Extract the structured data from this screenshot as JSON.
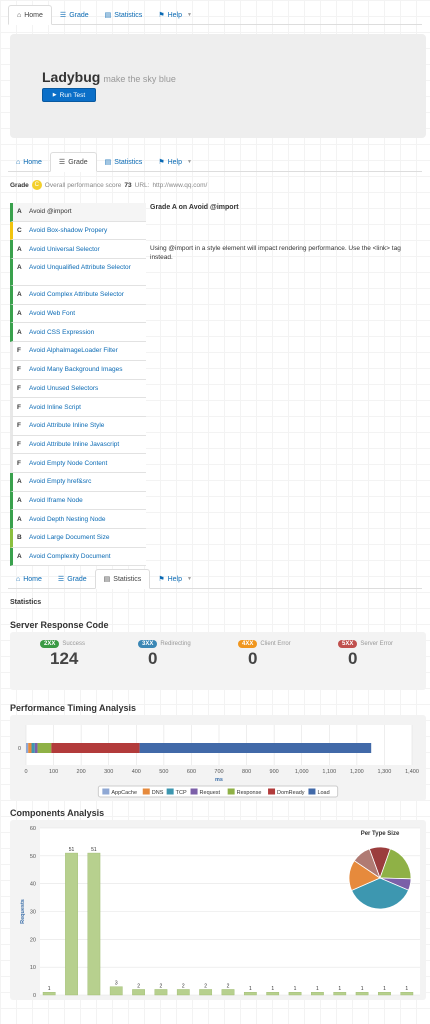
{
  "nav": {
    "tabs": [
      {
        "label": "Home"
      },
      {
        "label": "Grade"
      },
      {
        "label": "Statistics"
      },
      {
        "label": "Help"
      }
    ]
  },
  "hero": {
    "title": "Ladybug",
    "tagline": "make the sky blue",
    "button": "Run Test"
  },
  "grade": {
    "label": "Grade",
    "letter": "C",
    "score_label": "Overall performance score",
    "score": "73",
    "url_label": "URL:",
    "url": "http://www.qq.com/"
  },
  "rules": [
    {
      "grade": "A",
      "name": "Avoid @import"
    },
    {
      "grade": "C",
      "name": "Avoid Box-shadow Propery"
    },
    {
      "grade": "A",
      "name": "Avoid Universal Selector"
    },
    {
      "grade": "A",
      "name": "Avoid Unqualified Attribute Selector"
    },
    {
      "grade": "A",
      "name": "Avoid Complex Attribute Selector"
    },
    {
      "grade": "A",
      "name": "Avoid Web Font"
    },
    {
      "grade": "A",
      "name": "Avoid CSS Expression"
    },
    {
      "grade": "F",
      "name": "Avoid AlphaImageLoader Filter"
    },
    {
      "grade": "F",
      "name": "Avoid Many Background Images"
    },
    {
      "grade": "F",
      "name": "Avoid Unused Selectors"
    },
    {
      "grade": "F",
      "name": "Avoid Inline Script"
    },
    {
      "grade": "F",
      "name": "Avoid Attribute Inline Style"
    },
    {
      "grade": "F",
      "name": "Avoid Attribute Inline Javascript"
    },
    {
      "grade": "F",
      "name": "Avoid Empty Node Content"
    },
    {
      "grade": "A",
      "name": "Avoid Empty href&src"
    },
    {
      "grade": "A",
      "name": "Avoid Iframe Node"
    },
    {
      "grade": "A",
      "name": "Avoid Depth Nesting Node"
    },
    {
      "grade": "B",
      "name": "Avoid Large Document Size"
    },
    {
      "grade": "A",
      "name": "Avoid Complexity Document"
    }
  ],
  "detail": {
    "title": "Grade A on Avoid @import",
    "text": "Using @import in a style element will impact rendering performance. Use the <link> tag instead."
  },
  "statistics": {
    "heading": "Statistics",
    "server_title": "Server Response Code",
    "codes": [
      {
        "code": "2XX",
        "label": "Success",
        "count": "124",
        "color": "#3a9a44"
      },
      {
        "code": "3XX",
        "label": "Redirecting",
        "count": "0",
        "color": "#3b87b5"
      },
      {
        "code": "4XX",
        "label": "Client Error",
        "count": "0",
        "color": "#f0961e"
      },
      {
        "code": "5XX",
        "label": "Server Error",
        "count": "0",
        "color": "#c0504d"
      }
    ],
    "timing_title": "Performance Timing Analysis",
    "components_title": "Components Analysis"
  },
  "chart_data": [
    {
      "type": "bar",
      "orientation": "horizontal",
      "stacked": true,
      "categories": [
        "0"
      ],
      "xlabel": "ms",
      "xlim": [
        0,
        1400
      ],
      "xticks": [
        0,
        100,
        200,
        300,
        400,
        500,
        600,
        700,
        800,
        900,
        1000,
        1100,
        1200,
        1300,
        1400
      ],
      "xticklabels": [
        "0",
        "100",
        "200",
        "300",
        "400",
        "500",
        "600",
        "700",
        "800",
        "900",
        "1,000",
        "1,100",
        "1,200",
        "1,300",
        "1,400"
      ],
      "legend_position": "bottom",
      "series": [
        {
          "name": "AppCache",
          "values": [
            8
          ],
          "color": "#8fa8d4"
        },
        {
          "name": "DNS",
          "values": [
            12
          ],
          "color": "#e68a3c"
        },
        {
          "name": "TCP",
          "values": [
            12
          ],
          "color": "#3d97b0"
        },
        {
          "name": "Request",
          "values": [
            10
          ],
          "color": "#7b5fa8"
        },
        {
          "name": "Response",
          "values": [
            50
          ],
          "color": "#8fb146"
        },
        {
          "name": "DomReady",
          "values": [
            320
          ],
          "color": "#b23b3b"
        },
        {
          "name": "Load",
          "values": [
            840
          ],
          "color": "#4169a8"
        }
      ]
    },
    {
      "type": "bar",
      "ylabel": "Requests",
      "ylim": [
        0,
        60
      ],
      "yticks": [
        0,
        10,
        20,
        30,
        40,
        50,
        60
      ],
      "values": [
        1,
        51,
        51,
        3,
        2,
        2,
        2,
        2,
        2,
        1,
        1,
        1,
        1,
        1,
        1,
        1,
        1
      ],
      "color": "#b7d08e"
    },
    {
      "type": "pie",
      "title": "Per Type Size",
      "slices": [
        {
          "value": 11,
          "color": "#9b3d3d"
        },
        {
          "value": 20,
          "color": "#8fb146"
        },
        {
          "value": 6,
          "color": "#7b5fa8"
        },
        {
          "value": 37,
          "color": "#3d97b0"
        },
        {
          "value": 16,
          "color": "#e68a3c"
        },
        {
          "value": 10,
          "color": "#b07b73"
        }
      ]
    }
  ]
}
